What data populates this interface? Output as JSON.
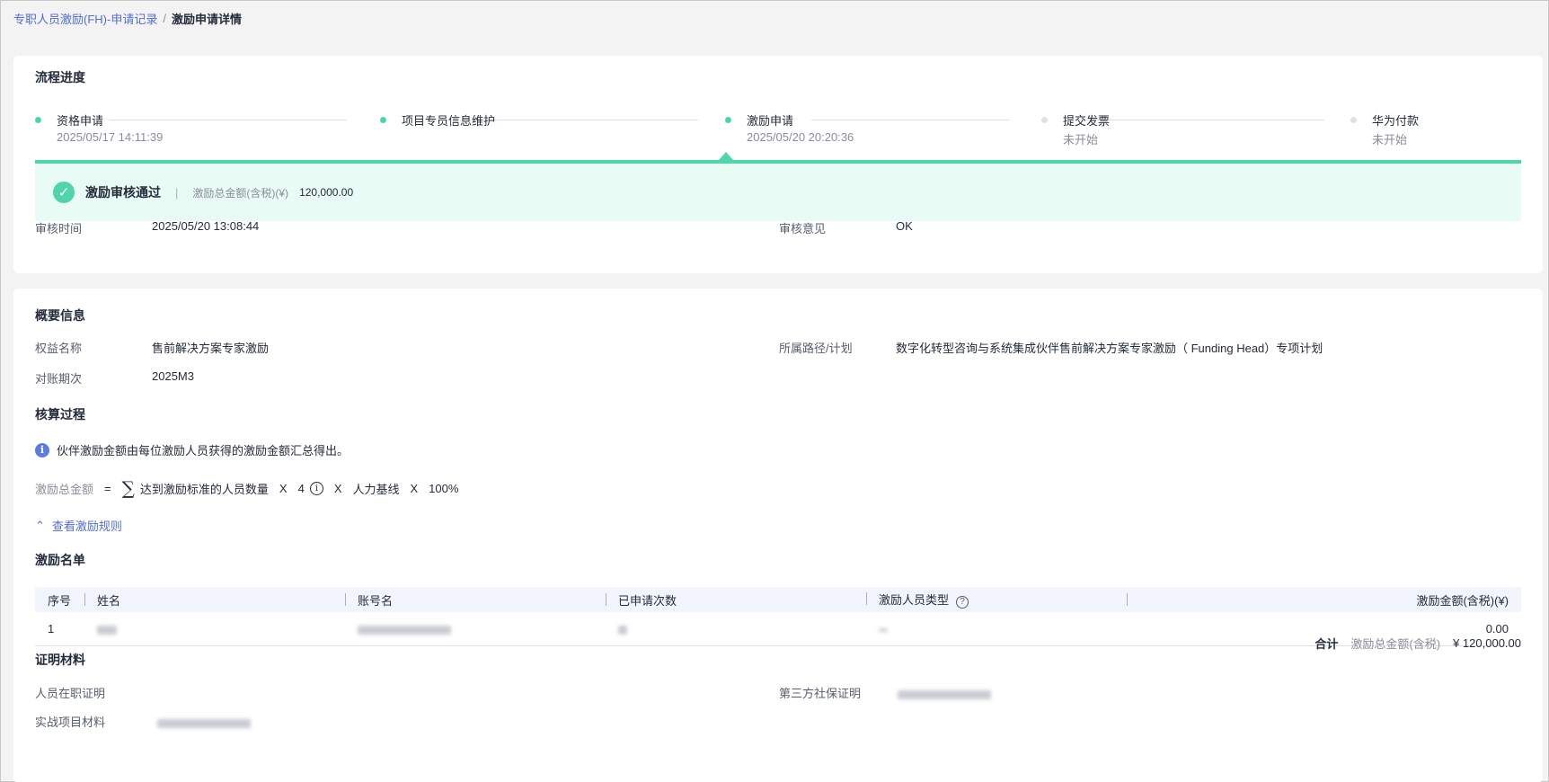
{
  "breadcrumb": {
    "parent": "专职人员激励(FH)-申请记录",
    "separator": "/",
    "current": "激励申请详情"
  },
  "progress": {
    "title": "流程进度",
    "steps": [
      {
        "name": "资格申请",
        "time": "2025/05/17 14:11:39",
        "state": "done"
      },
      {
        "name": "项目专员信息维护",
        "time": "",
        "state": "done"
      },
      {
        "name": "激励申请",
        "time": "2025/05/20 20:20:36",
        "state": "current"
      },
      {
        "name": "提交发票",
        "time": "未开始",
        "state": "pending"
      },
      {
        "name": "华为付款",
        "time": "未开始",
        "state": "pending"
      }
    ],
    "status": {
      "text": "激励审核通过",
      "sep": "|",
      "amount_label": "激励总金额(含税)(¥)",
      "amount": "120,000.00"
    },
    "review_time_label": "审核时间",
    "review_time": "2025/05/20 13:08:44",
    "review_opinion_label": "审核意见",
    "review_opinion": "OK"
  },
  "summary": {
    "title": "概要信息",
    "benefit_label": "权益名称",
    "benefit": "售前解决方案专家激励",
    "path_label": "所属路径/计划",
    "path": "数字化转型咨询与系统集成伙伴售前解决方案专家激励（ Funding Head）专项计划",
    "period_label": "对账期次",
    "period": "2025M3"
  },
  "calculation": {
    "title": "核算过程",
    "info": "伙伴激励金额由每位激励人员获得的激励金额汇总得出。",
    "formula": {
      "label": "激励总金额",
      "eq": "=",
      "sigma": "∑",
      "term1": "达到激励标准的人员数量",
      "x1": "X",
      "num": "4",
      "x2": "X",
      "term2": "人力基线",
      "x3": "X",
      "pct": "100%"
    },
    "rules_link": "查看激励规则"
  },
  "list": {
    "title": "激励名单",
    "columns": [
      "序号",
      "姓名",
      "账号名",
      "已申请次数",
      "激励人员类型",
      "激励金额(含税)(¥)"
    ],
    "rows": [
      {
        "index": "1",
        "amount": "0.00"
      }
    ],
    "total_head": "合计",
    "total_label": "激励总金额(含税)",
    "total_value": "¥ 120,000.00"
  },
  "proof": {
    "title": "证明材料",
    "employment_label": "人员在职证明",
    "social_label": "第三方社保证明",
    "project_label": "实战项目材料"
  },
  "colors": {
    "accent": "#50d4ab",
    "link": "#526ecc",
    "success_bg": "#e8fbf5",
    "info": "#5e7ce0"
  },
  "icons": [
    "check-icon",
    "info-icon",
    "chevron-up-icon",
    "help-icon"
  ]
}
